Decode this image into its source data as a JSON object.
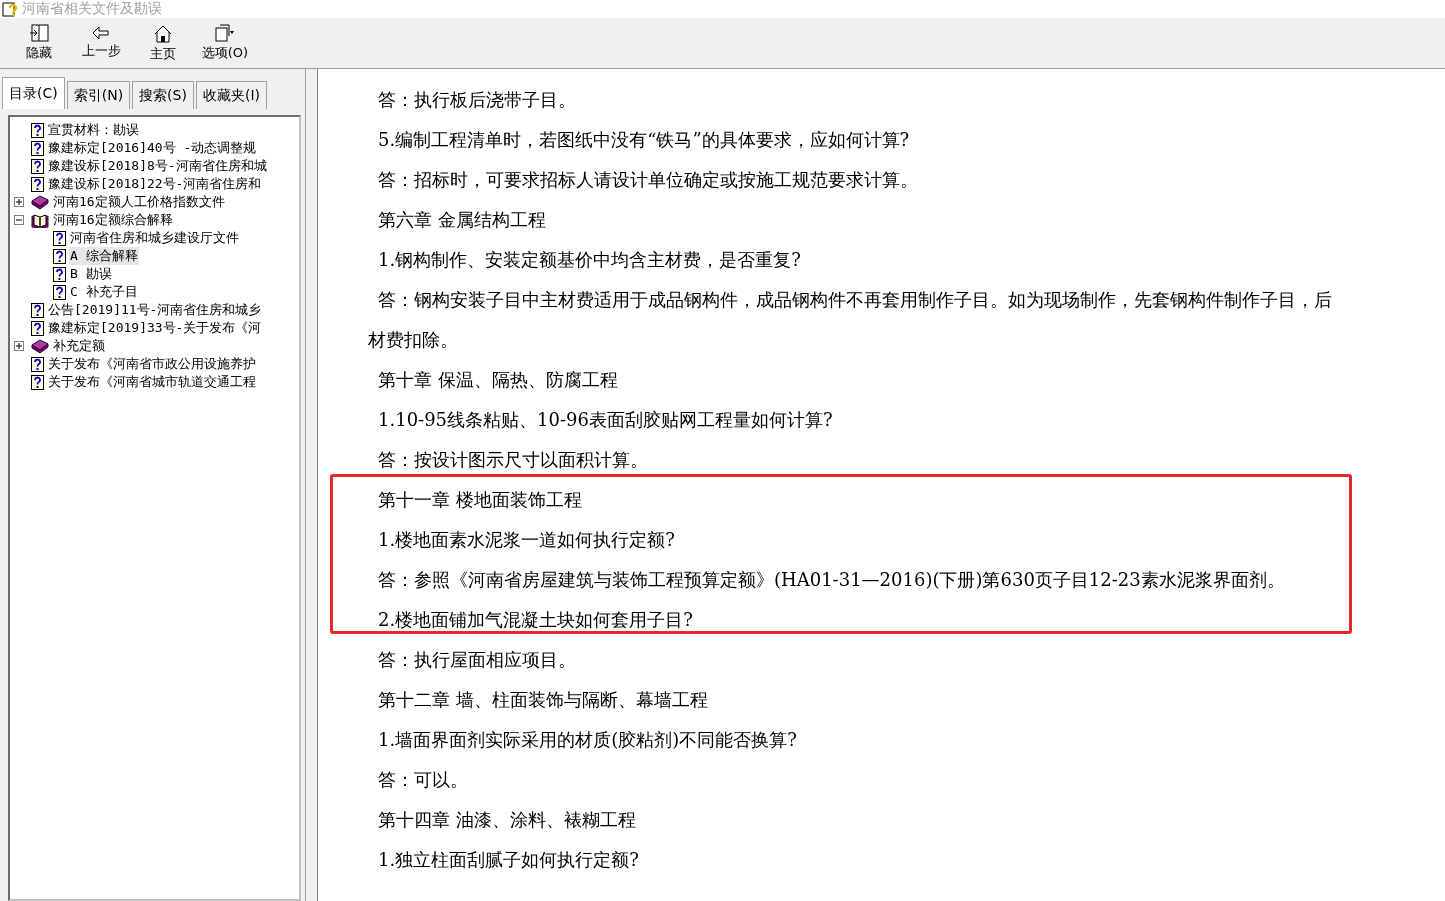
{
  "window": {
    "title": "河南省相关文件及勘误"
  },
  "toolbar": [
    {
      "label": "隐藏",
      "kind": "hide"
    },
    {
      "label": "上一步",
      "kind": "back"
    },
    {
      "label": "主页",
      "kind": "home"
    },
    {
      "label": "选项(O)",
      "kind": "options"
    }
  ],
  "tabs": [
    {
      "label": "目录(C)",
      "selected": true
    },
    {
      "label": "索引(N)",
      "selected": false
    },
    {
      "label": "搜索(S)",
      "selected": false
    },
    {
      "label": "收藏夹(I)",
      "selected": false
    }
  ],
  "tree": [
    {
      "kind": "page",
      "label": "宣贯材料：勘误",
      "selected": false
    },
    {
      "kind": "page",
      "label": "豫建标定[2016]40号 -动态调整规",
      "selected": false
    },
    {
      "kind": "page",
      "label": "豫建设标[2018]8号-河南省住房和城",
      "selected": false
    },
    {
      "kind": "page",
      "label": "豫建设标[2018]22号-河南省住房和",
      "selected": false
    },
    {
      "kind": "book",
      "label": "河南16定额人工价格指数文件",
      "expanded": false,
      "selected": false
    },
    {
      "kind": "book",
      "label": "河南16定额综合解释",
      "expanded": true,
      "selected": false,
      "children": [
        {
          "kind": "page",
          "label": "河南省住房和城乡建设厅文件",
          "selected": false
        },
        {
          "kind": "page",
          "label": "A 综合解释",
          "selected": true
        },
        {
          "kind": "page",
          "label": "B 勘误",
          "selected": false
        },
        {
          "kind": "page",
          "label": "C 补充子目",
          "selected": false
        }
      ]
    },
    {
      "kind": "page",
      "label": "公告[2019]11号-河南省住房和城乡",
      "selected": false
    },
    {
      "kind": "page",
      "label": "豫建标定[2019]33号-关于发布《河",
      "selected": false
    },
    {
      "kind": "book",
      "label": "补充定额",
      "expanded": false,
      "selected": false
    },
    {
      "kind": "page",
      "label": "关于发布《河南省市政公用设施养护",
      "selected": false
    },
    {
      "kind": "page",
      "label": "关于发布《河南省城市轨道交通工程",
      "selected": false
    }
  ],
  "content": [
    {
      "kind": "para",
      "text": "答：执行板后浇带子目。",
      "boxed": false
    },
    {
      "kind": "para",
      "text": "5.编制工程清单时，若图纸中没有“铁马”的具体要求，应如何计算?",
      "boxed": false
    },
    {
      "kind": "para",
      "text": "答：招标时，可要求招标人请设计单位确定或按施工规范要求计算。",
      "boxed": false
    },
    {
      "kind": "para",
      "text": "第六章  金属结构工程",
      "boxed": false
    },
    {
      "kind": "para",
      "text": "1.钢构制作、安装定额基价中均含主材费，是否重复?",
      "boxed": false
    },
    {
      "kind": "para",
      "text": "答：钢构安装子目中主材费适用于成品钢构件，成品钢构件不再套用制作子目。如为现场制作，先套钢构件制作子目，后",
      "boxed": false
    },
    {
      "kind": "wrap",
      "text": "材费扣除。",
      "boxed": false
    },
    {
      "kind": "para",
      "text": "第十章  保温、隔热、防腐工程",
      "boxed": false
    },
    {
      "kind": "para",
      "text": "1.10-95线条粘贴、10-96表面刮胶贴网工程量如何计算?",
      "boxed": false
    },
    {
      "kind": "para",
      "text": "答：按设计图示尺寸以面积计算。",
      "boxed": false
    },
    {
      "kind": "para",
      "text": "第十一章  楼地面装饰工程",
      "boxed": true
    },
    {
      "kind": "para",
      "text": "1.楼地面素水泥浆一道如何执行定额?",
      "boxed": true
    },
    {
      "kind": "para",
      "text": "答：参照《河南省房屋建筑与装饰工程预算定额》(HA01-31—2016)(下册)第630页子目12-23素水泥浆界面剂。",
      "boxed": true
    },
    {
      "kind": "para",
      "text": "2.楼地面铺加气混凝土块如何套用子目?",
      "boxed": true
    },
    {
      "kind": "para",
      "text": "答：执行屋面相应项目。",
      "boxed": false
    },
    {
      "kind": "para",
      "text": "第十二章  墙、柱面装饰与隔断、幕墙工程",
      "boxed": false
    },
    {
      "kind": "para",
      "text": "1.墙面界面剂实际采用的材质(胶粘剂)不同能否换算?",
      "boxed": false
    },
    {
      "kind": "para",
      "text": "答：可以。",
      "boxed": false
    },
    {
      "kind": "para",
      "text": "第十四章  油漆、涂料、裱糊工程",
      "boxed": false
    },
    {
      "kind": "para",
      "text": "1.独立柱面刮腻子如何执行定额?",
      "boxed": false
    }
  ]
}
